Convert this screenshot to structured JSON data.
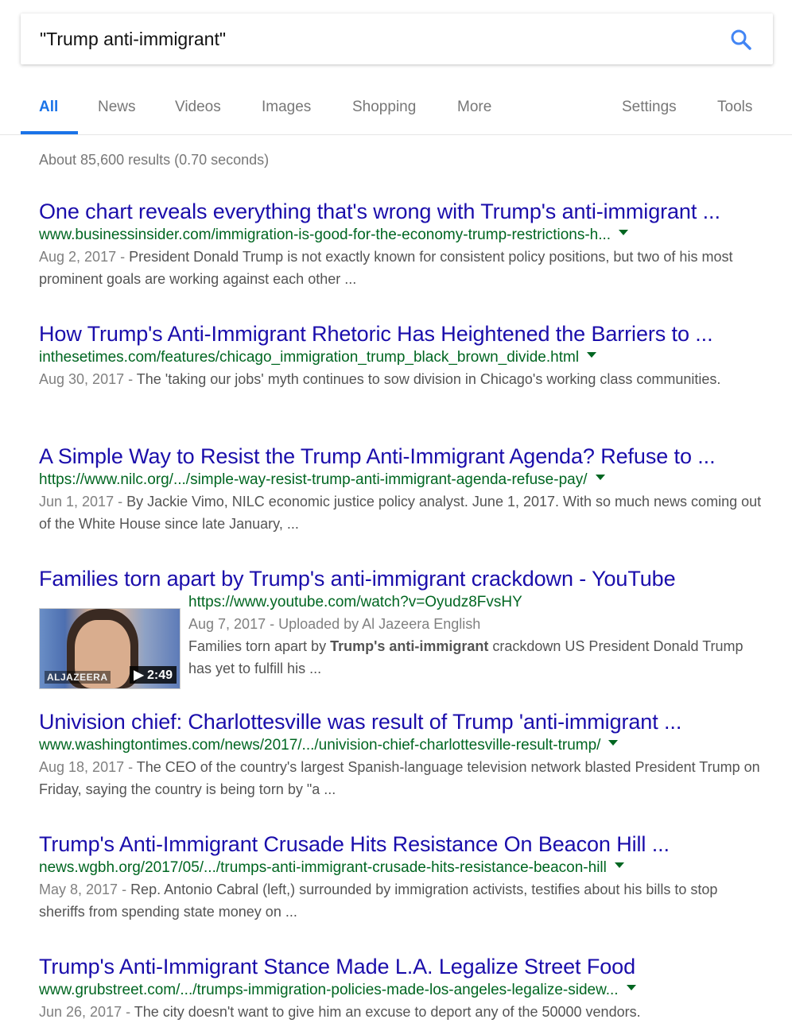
{
  "search": {
    "query": "\"Trump anti-immigrant\"",
    "button_icon": "search-icon",
    "accent_color": "#4285f4"
  },
  "tabs": {
    "items": [
      "All",
      "News",
      "Videos",
      "Images",
      "Shopping",
      "More"
    ],
    "right": [
      "Settings",
      "Tools"
    ],
    "active": "All"
  },
  "stats": "About 85,600 results (0.70 seconds)",
  "results": [
    {
      "title": "One chart reveals everything that's wrong with Trump's anti-immigrant ...",
      "url": "www.businessinsider.com/immigration-is-good-for-the-economy-trump-restrictions-h...",
      "date": "Aug 2, 2017 - ",
      "snippet": "President Donald Trump is not exactly known for consistent policy positions, but two of his most prominent goals are working against each other ..."
    },
    {
      "title": "How Trump's Anti-Immigrant Rhetoric Has Heightened the Barriers to ...",
      "url": "inthesetimes.com/features/chicago_immigration_trump_black_brown_divide.html",
      "date": "Aug 30, 2017 - ",
      "snippet": "The 'taking our jobs' myth continues to sow division in Chicago's working class communities."
    },
    {
      "title": "A Simple Way to Resist the Trump Anti-Immigrant Agenda? Refuse to ...",
      "url": "https://www.nilc.org/.../simple-way-resist-trump-anti-immigrant-agenda-refuse-pay/",
      "date": "Jun 1, 2017 - ",
      "snippet": "By Jackie Vimo, NILC economic justice policy analyst. June 1, 2017. With so much news coming out of the White House since late January, ..."
    },
    {
      "title": "Families torn apart by Trump's anti-immigrant crackdown - YouTube",
      "url": "https://www.youtube.com/watch?v=Oyudz8FvsHY",
      "date": "Aug 7, 2017 - Uploaded by Al Jazeera English",
      "snippet_pre": "Families torn apart by ",
      "snippet_bold": "Trump's anti-immigrant",
      "snippet_post": " crackdown US President Donald Trump has yet to fulfill his ...",
      "thumb_logo": "ALJAZEERA",
      "duration": "▶ 2:49"
    },
    {
      "title": "Univision chief: Charlottesville was result of Trump 'anti-immigrant ...",
      "url": "www.washingtontimes.com/news/2017/.../univision-chief-charlottesville-result-trump/",
      "date": "Aug 18, 2017 - ",
      "snippet": "The CEO of the country's largest Spanish-language television network blasted President Trump on Friday, saying the country is being torn by \"a ..."
    },
    {
      "title": "Trump's Anti-Immigrant Crusade Hits Resistance On Beacon Hill ...",
      "url": "news.wgbh.org/2017/05/.../trumps-anti-immigrant-crusade-hits-resistance-beacon-hill",
      "date": "May 8, 2017 - ",
      "snippet": "Rep. Antonio Cabral (left,) surrounded by immigration activists, testifies about his bills to stop sheriffs from spending state money on ..."
    },
    {
      "title": "Trump's Anti-Immigrant Stance Made L.A. Legalize Street Food",
      "url": "www.grubstreet.com/.../trumps-immigration-policies-made-los-angeles-legalize-sidew...",
      "date": "Jun 26, 2017 - ",
      "snippet": "The city doesn't want to give him an excuse to deport any of the 50000 vendors."
    }
  ]
}
